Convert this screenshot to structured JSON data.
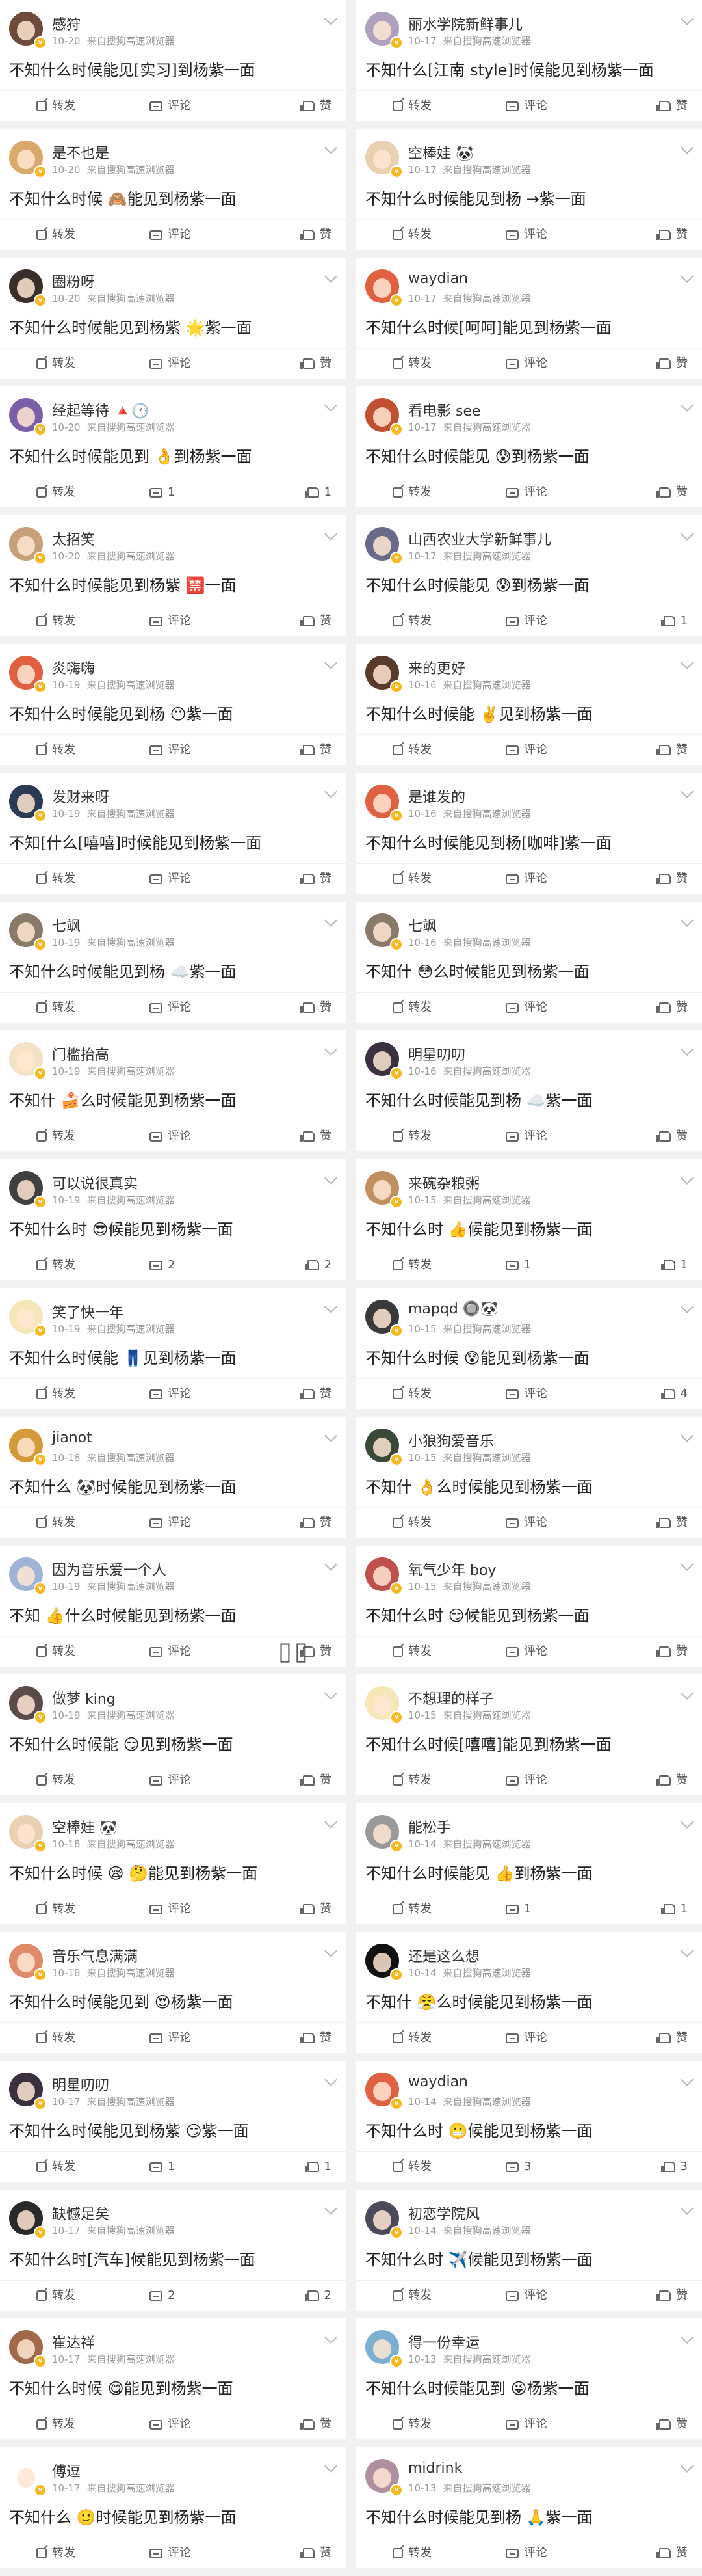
{
  "actions": {
    "repost": "转发",
    "comment": "评论",
    "like": "赞"
  },
  "overlay": {
    "pause_icon": "▯▯"
  },
  "posts": [
    {
      "nick": "感狩",
      "date": "10-20",
      "source": "来自搜狗高速浏览器",
      "content": "不知什么时候能见[实习]到杨紫一面",
      "comments": "",
      "likes": "",
      "avatar": "#6d4a3a"
    },
    {
      "nick": "是不也是",
      "date": "10-20",
      "source": "来自搜狗高速浏览器",
      "content": "不知什么时候 🙈能见到杨紫一面",
      "comments": "",
      "likes": "",
      "avatar": "#d9a86a"
    },
    {
      "nick": "圈粉呀",
      "date": "10-20",
      "source": "来自搜狗高速浏览器",
      "content": "不知什么时候能见到杨紫 🌟紫一面",
      "comments": "",
      "likes": "",
      "avatar": "#3a2e2a"
    },
    {
      "nick": "经起等待 🔺🕐",
      "date": "10-20",
      "source": "来自搜狗高速浏览器",
      "content": "不知什么时候能见到 👌到杨紫一面",
      "comments": "1",
      "likes": "1",
      "avatar": "#7a5fa8"
    },
    {
      "nick": "太招笑",
      "date": "10-20",
      "source": "来自搜狗高速浏览器",
      "content": "不知什么时候能见到杨紫 🈲一面",
      "comments": "",
      "likes": "",
      "avatar": "#c7a07a"
    },
    {
      "nick": "炎嗨嗨",
      "date": "10-19",
      "source": "来自搜狗高速浏览器",
      "content": "不知什么时候能见到杨 😶紫一面",
      "comments": "",
      "likes": "",
      "avatar": "#e06040"
    },
    {
      "nick": "发财来呀",
      "date": "10-19",
      "source": "来自搜狗高速浏览器",
      "content": "不知[什么[嘻嘻]时候能见到杨紫一面",
      "comments": "",
      "likes": "",
      "avatar": "#2b3a55"
    },
    {
      "nick": "七飒",
      "date": "10-19",
      "source": "来自搜狗高速浏览器",
      "content": "不知什么时候能见到杨 ☁️紫一面",
      "comments": "",
      "likes": "",
      "avatar": "#8a7a6a"
    },
    {
      "nick": "门槛抬高",
      "date": "10-19",
      "source": "来自搜狗高速浏览器",
      "content": "不知什 🍰么时候能见到杨紫一面",
      "comments": "",
      "likes": "",
      "avatar": "#f4e2c4"
    },
    {
      "nick": "可以说很真实",
      "date": "10-19",
      "source": "来自搜狗高速浏览器",
      "content": "不知什么时 😎候能见到杨紫一面",
      "comments": "2",
      "likes": "2",
      "avatar": "#404040"
    },
    {
      "nick": "笑了快一年",
      "date": "10-19",
      "source": "来自搜狗高速浏览器",
      "content": "不知什么时候能 👖见到杨紫一面",
      "comments": "",
      "likes": "",
      "avatar": "#f6e7b8"
    },
    {
      "nick": "jianot",
      "date": "10-18",
      "source": "来自搜狗高速浏览器",
      "content": "不知什么 🐼时候能见到杨紫一面",
      "comments": "",
      "likes": "",
      "avatar": "#d49a3a"
    },
    {
      "nick": "因为音乐爱一个人",
      "date": "10-19",
      "source": "来自搜狗高速浏览器",
      "content": "不知 👍什么时候能见到杨紫一面",
      "comments": "",
      "likes": "",
      "avatar": "#9fb4d4"
    },
    {
      "nick": "做梦 king",
      "date": "10-19",
      "source": "来自搜狗高速浏览器",
      "content": "不知什么时候能 😏见到杨紫一面",
      "comments": "",
      "likes": "",
      "avatar": "#5a4a4a"
    },
    {
      "nick": "空棒娃 🐼",
      "date": "10-18",
      "source": "来自搜狗高速浏览器",
      "content": "不知什么时候 😪 🤔能见到杨紫一面",
      "comments": "",
      "likes": "",
      "avatar": "#e8d0b0"
    },
    {
      "nick": "音乐气息满满",
      "date": "10-18",
      "source": "来自搜狗高速浏览器",
      "content": "不知什么时候能见到 😍杨紫一面",
      "comments": "",
      "likes": "",
      "avatar": "#e08a6a"
    },
    {
      "nick": "明星叨叨",
      "date": "10-17",
      "source": "来自搜狗高速浏览器",
      "content": "不知什么时候能见到杨紫 😏紫一面",
      "comments": "1",
      "likes": "1",
      "avatar": "#3a3040"
    },
    {
      "nick": "缺憾足矣",
      "date": "10-17",
      "source": "来自搜狗高速浏览器",
      "content": "不知什么时[汽车]候能见到杨紫一面",
      "comments": "2",
      "likes": "2",
      "avatar": "#2a2a2a"
    },
    {
      "nick": "崔达祥",
      "date": "10-17",
      "source": "来自搜狗高速浏览器",
      "content": "不知什么时候 😋能见到杨紫一面",
      "comments": "",
      "likes": "",
      "avatar": "#a06a4a"
    },
    {
      "nick": "傅逗",
      "date": "10-17",
      "source": "来自搜狗高速浏览器",
      "content": "不知什么 🙂时候能见到杨紫一面",
      "comments": "",
      "likes": "",
      "avatar": "#ffffff"
    },
    {
      "nick": "丽水学院新鲜事儿",
      "date": "10-17",
      "source": "来自搜狗高速浏览器",
      "content": "不知什么[江南 style]时候能见到杨紫一面",
      "comments": "",
      "likes": "",
      "avatar": "#b0a0c0"
    },
    {
      "nick": "空棒娃 🐼",
      "date": "10-17",
      "source": "来自搜狗高速浏览器",
      "content": "不知什么时候能见到杨 →紫一面",
      "comments": "",
      "likes": "",
      "avatar": "#e8d0b0"
    },
    {
      "nick": "waydian",
      "date": "10-17",
      "source": "来自搜狗高速浏览器",
      "content": "不知什么时候[呵呵]能见到杨紫一面",
      "comments": "",
      "likes": "",
      "avatar": "#e06040"
    },
    {
      "nick": "看电影 see",
      "date": "10-17",
      "source": "来自搜狗高速浏览器",
      "content": "不知什么时候能见 😰到杨紫一面",
      "comments": "",
      "likes": "",
      "avatar": "#c05030"
    },
    {
      "nick": "山西农业大学新鲜事儿",
      "date": "10-17",
      "source": "来自搜狗高速浏览器",
      "content": "不知什么时候能见 😰到杨紫一面",
      "comments": "",
      "likes": "1",
      "avatar": "#6a6a8a"
    },
    {
      "nick": "来的更好",
      "date": "10-16",
      "source": "来自搜狗高速浏览器",
      "content": "不知什么时候能 ✌️见到杨紫一面",
      "comments": "",
      "likes": "",
      "avatar": "#5a3a2a"
    },
    {
      "nick": "是谁发的",
      "date": "10-16",
      "source": "来自搜狗高速浏览器",
      "content": "不知什么时候能见到杨[咖啡]紫一面",
      "comments": "",
      "likes": "",
      "avatar": "#e06040"
    },
    {
      "nick": "七飒",
      "date": "10-16",
      "source": "来自搜狗高速浏览器",
      "content": "不知什 😳么时候能见到杨紫一面",
      "comments": "",
      "likes": "",
      "avatar": "#8a7a6a"
    },
    {
      "nick": "明星叨叨",
      "date": "10-16",
      "source": "来自搜狗高速浏览器",
      "content": "不知什么时候能见到杨 ☁️紫一面",
      "comments": "",
      "likes": "",
      "avatar": "#3a3040"
    },
    {
      "nick": "来碗杂粮粥",
      "date": "10-15",
      "source": "来自搜狗高速浏览器",
      "content": "不知什么时 👍候能见到杨紫一面",
      "comments": "1",
      "likes": "1",
      "avatar": "#c09060"
    },
    {
      "nick": "mapqd 🔘🐼",
      "date": "10-15",
      "source": "来自搜狗高速浏览器",
      "content": "不知什么时候 😰能见到杨紫一面",
      "comments": "",
      "likes": "4",
      "avatar": "#3a3a3a"
    },
    {
      "nick": "小狼狗爱音乐",
      "date": "10-15",
      "source": "来自搜狗高速浏览器",
      "content": "不知什 👌么时候能见到杨紫一面",
      "comments": "",
      "likes": "",
      "avatar": "#3a4a3a"
    },
    {
      "nick": "氧气少年 boy",
      "date": "10-15",
      "source": "来自搜狗高速浏览器",
      "content": "不知什么时 😏候能见到杨紫一面",
      "comments": "",
      "likes": "",
      "avatar": "#c0504a"
    },
    {
      "nick": "不想理的样子",
      "date": "10-15",
      "source": "来自搜狗高速浏览器",
      "content": "不知什么时候[嘻嘻]能见到杨紫一面",
      "comments": "",
      "likes": "",
      "avatar": "#f6e7b8"
    },
    {
      "nick": "能松手",
      "date": "10-14",
      "source": "来自搜狗高速浏览器",
      "content": "不知什么时候能见 👍到杨紫一面",
      "comments": "1",
      "likes": "1",
      "avatar": "#9a9a9a"
    },
    {
      "nick": "还是这么想",
      "date": "10-14",
      "source": "来自搜狗高速浏览器",
      "content": "不知什 😤么时候能见到杨紫一面",
      "comments": "",
      "likes": "",
      "avatar": "#111111"
    },
    {
      "nick": "waydian",
      "date": "10-14",
      "source": "来自搜狗高速浏览器",
      "content": "不知什么时 😬候能见到杨紫一面",
      "comments": "3",
      "likes": "3",
      "avatar": "#e06040"
    },
    {
      "nick": "初恋学院风",
      "date": "10-14",
      "source": "来自搜狗高速浏览器",
      "content": "不知什么时 ✈️候能见到杨紫一面",
      "comments": "",
      "likes": "",
      "avatar": "#4a4a5a"
    },
    {
      "nick": "得一份幸运",
      "date": "10-13",
      "source": "来自搜狗高速浏览器",
      "content": "不知什么时候能见到 😜杨紫一面",
      "comments": "",
      "likes": "",
      "avatar": "#7ab0d0"
    },
    {
      "nick": "midrink",
      "date": "10-13",
      "source": "来自搜狗高速浏览器",
      "content": "不知什么时候能见到杨 🙏紫一面",
      "comments": "",
      "likes": "",
      "avatar": "#b090a0"
    }
  ]
}
